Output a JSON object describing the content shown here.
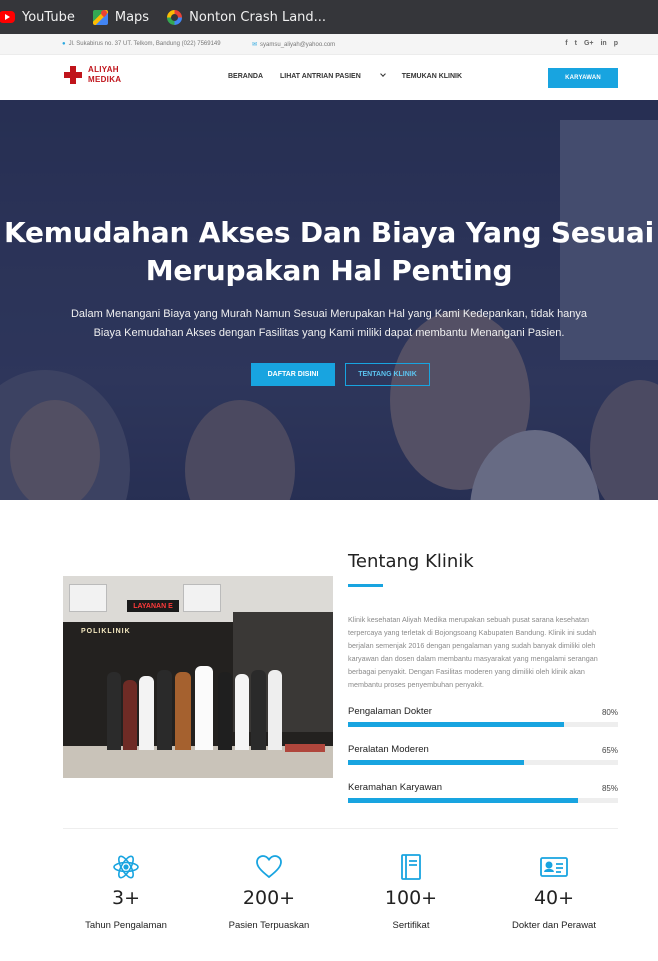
{
  "bookmarks": [
    {
      "label": "YouTube",
      "icon": "youtube-icon"
    },
    {
      "label": "Maps",
      "icon": "maps-icon"
    },
    {
      "label": "Nonton Crash Land...",
      "icon": "site-icon"
    }
  ],
  "topbar": {
    "address": "Jl. Sukabirus no. 37 UT. Telkom, Bandung (022) 7569149",
    "email": "syamsu_aliyah@yahoo.com",
    "social": [
      "f",
      "t",
      "G+",
      "in",
      "p"
    ]
  },
  "brand": {
    "line1": "ALIYAH",
    "line2": "MEDIKA",
    "color": "#c0141b"
  },
  "nav": {
    "items": [
      "BERANDA",
      "LIHAT ANTRIAN PASIEN",
      "TEMUKAN KLINIK"
    ],
    "cta": "KARYAWAN"
  },
  "hero": {
    "title": "Kemudahan Akses Dan Biaya Yang Sesuai Merupakan Hal Penting",
    "text": "Dalam Menangani Biaya yang Murah Namun Sesuai Merupakan Hal yang Kami Kedepankan, tidak hanya Biaya Kemudahan Akses dengan Fasilitas yang Kami miliki dapat membantu Menangani Pasien.",
    "primary_button": "DAFTAR DISINI",
    "secondary_button": "TENTANG KLINIK"
  },
  "about": {
    "title": "Tentang Klinik",
    "text": "Klinik kesehatan Aliyah Medika merupakan sebuah pusat sarana kesehatan terpercaya yang terletak di Bojongsoang Kabupaten Bandung. Klinik ini sudah berjalan semenjak 2016 dengan pengalaman yang sudah banyak dimiliki oleh karyawan dan dosen dalam membantu masyarakat yang mengalami serangan berbagai penyakit. Dengan Fasilitas moderen yang dimiliki oleh klinik akan membantu proses penyembuhan penyakit.",
    "photo_signs": {
      "poliklinik": "POLIKLINIK",
      "layanan": "LAYANAN E"
    },
    "skills": [
      {
        "label": "Pengalaman Dokter",
        "percent": 80,
        "percent_text": "80%"
      },
      {
        "label": "Peralatan Moderen",
        "percent": 65,
        "percent_text": "65%"
      },
      {
        "label": "Keramahan Karyawan",
        "percent": 85,
        "percent_text": "85%"
      }
    ]
  },
  "stats": [
    {
      "icon": "atom-icon",
      "number": "3+",
      "label": "Tahun Pengalaman"
    },
    {
      "icon": "heart-icon",
      "number": "200+",
      "label": "Pasien Terpuaskan"
    },
    {
      "icon": "certificate-icon",
      "number": "100+",
      "label": "Sertifikat"
    },
    {
      "icon": "id-card-icon",
      "number": "40+",
      "label": "Dokter dan Perawat"
    }
  ],
  "colors": {
    "accent": "#18a4e0",
    "hero_overlay": "#2a3354"
  }
}
